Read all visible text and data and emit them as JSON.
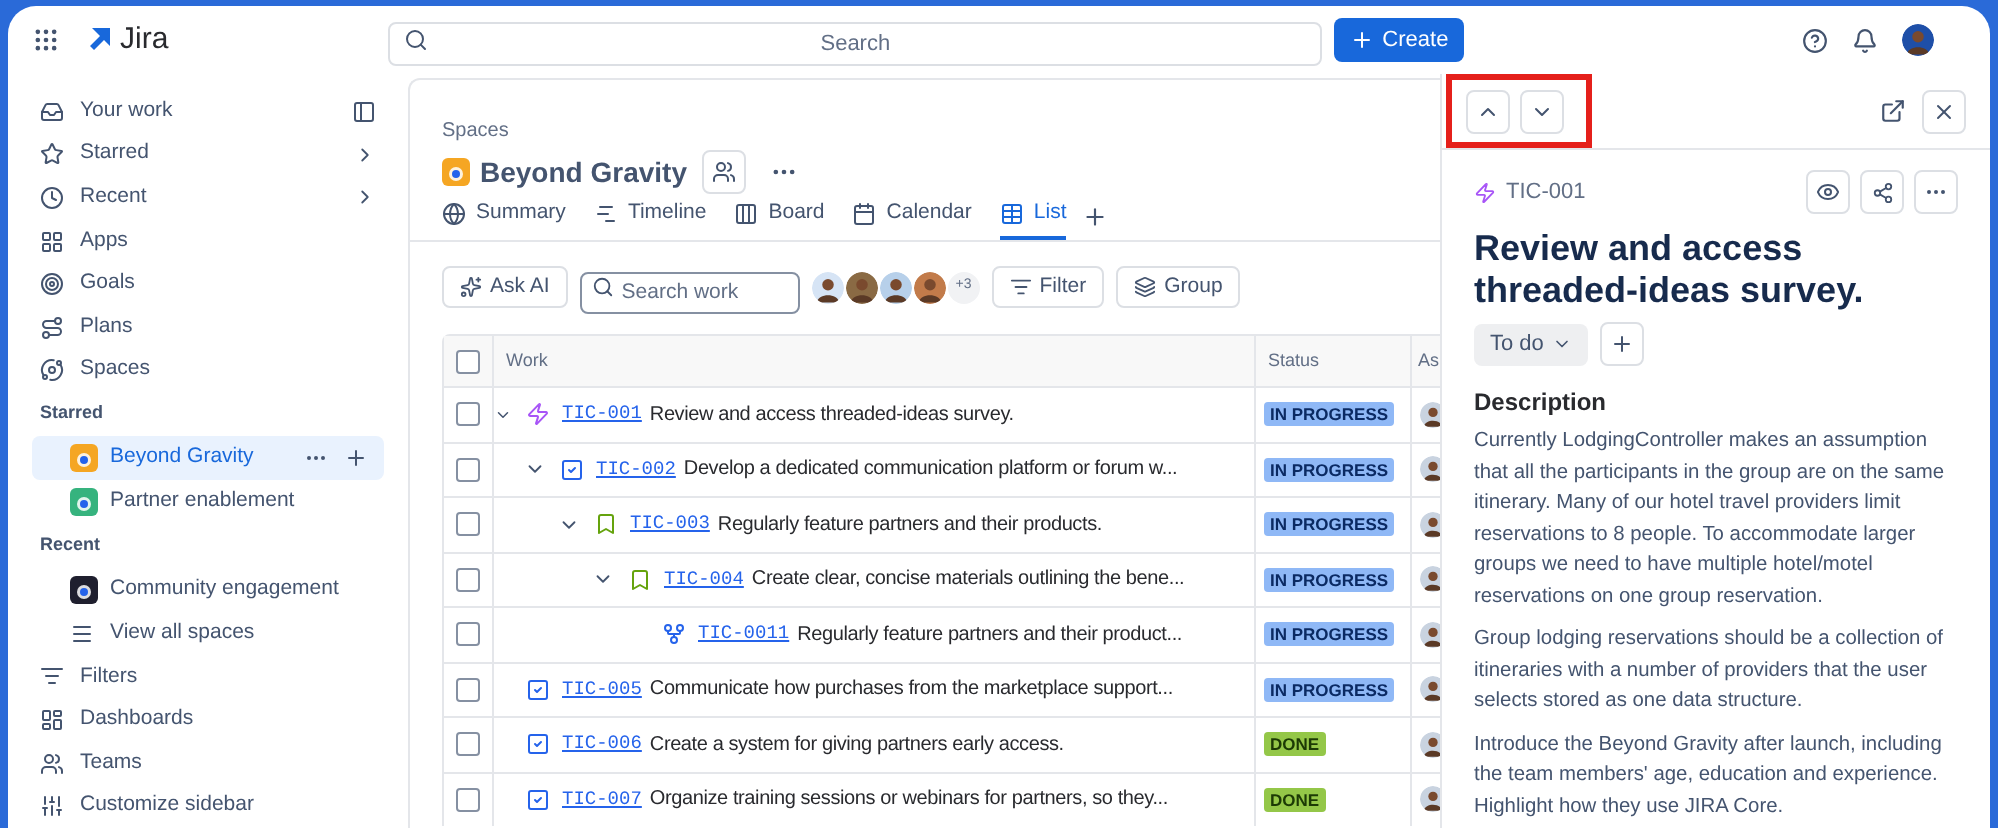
{
  "topbar": {
    "product": "Jira",
    "search": {
      "placeholder": "Search"
    },
    "create_button": "Create"
  },
  "sidebar": {
    "items": [
      {
        "label": "Your work"
      },
      {
        "label": "Starred"
      },
      {
        "label": "Recent"
      },
      {
        "label": "Apps"
      },
      {
        "label": "Goals"
      },
      {
        "label": "Plans"
      },
      {
        "label": "Spaces"
      }
    ],
    "sections": [
      {
        "heading": "Starred",
        "spaces": [
          {
            "label": "Beyond Gravity",
            "color": "#f5a623",
            "selected": true
          },
          {
            "label": "Partner enablement",
            "color": "#36b37e",
            "selected": false
          }
        ]
      },
      {
        "heading": "Recent",
        "spaces": [
          {
            "label": "Community engagement",
            "color": "#1f1f2e",
            "selected": false
          }
        ]
      }
    ],
    "view_all": "View all spaces",
    "bottom_items": [
      {
        "label": "Filters"
      },
      {
        "label": "Dashboards"
      },
      {
        "label": "Teams"
      },
      {
        "label": "Customize sidebar"
      }
    ]
  },
  "space": {
    "breadcrumb": "Spaces",
    "title": "Beyond Gravity",
    "tabs": [
      {
        "label": "Summary",
        "selected": false
      },
      {
        "label": "Timeline",
        "selected": false
      },
      {
        "label": "Board",
        "selected": false
      },
      {
        "label": "Calendar",
        "selected": false
      },
      {
        "label": "List",
        "selected": true
      }
    ]
  },
  "toolbar": {
    "ask_ai": "Ask AI",
    "search": {
      "placeholder": "Search work"
    },
    "more_people": "+3",
    "filter": "Filter",
    "group": "Group"
  },
  "table": {
    "columns": [
      "Work",
      "Status",
      "As"
    ],
    "all_checked": false,
    "rows": [
      {
        "key": "TIC-001",
        "kind": "epic",
        "summary": "Review and access threaded-ideas survey.",
        "status": {
          "label": "IN PROGRESS",
          "kind": "in_progress"
        },
        "checked": false,
        "expanded": true,
        "children": [
          {
            "key": "TIC-002",
            "kind": "task",
            "summary": "Develop a dedicated communication platform or forum w...",
            "status": {
              "label": "IN PROGRESS",
              "kind": "in_progress"
            },
            "checked": false,
            "expanded": true,
            "children": [
              {
                "key": "TIC-003",
                "kind": "story",
                "summary": "Regularly feature partners and their products.",
                "status": {
                  "label": "IN PROGRESS",
                  "kind": "in_progress"
                },
                "checked": false,
                "expanded": true,
                "children": [
                  {
                    "key": "TIC-004",
                    "kind": "story",
                    "summary": "Create clear, concise materials outlining the bene...",
                    "status": {
                      "label": "IN PROGRESS",
                      "kind": "in_progress"
                    },
                    "checked": false,
                    "expanded": true,
                    "children": [
                      {
                        "key": "TIC-0011",
                        "kind": "subtask",
                        "summary": "Regularly feature partners and their product...",
                        "status": {
                          "label": "IN PROGRESS",
                          "kind": "in_progress"
                        },
                        "checked": false
                      }
                    ]
                  }
                ]
              }
            ]
          }
        ]
      },
      {
        "key": "TIC-005",
        "kind": "task",
        "summary": "Communicate how purchases from the marketplace support...",
        "status": {
          "label": "IN PROGRESS",
          "kind": "in_progress"
        },
        "checked": false
      },
      {
        "key": "TIC-006",
        "kind": "task",
        "summary": "Create a system for giving partners early access.",
        "status": {
          "label": "DONE",
          "kind": "done"
        },
        "checked": false
      },
      {
        "key": "TIC-007",
        "kind": "task",
        "summary": "Organize training sessions or webinars for partners, so they...",
        "status": {
          "label": "DONE",
          "kind": "done"
        },
        "checked": false
      }
    ]
  },
  "detail": {
    "key": "TIC-001",
    "title": "Review and access threaded-ideas survey.",
    "status_button": "To do",
    "description_heading": "Description",
    "paragraphs": [
      "Currently LodgingController makes an assumption that all the participants in the group are on the same itinerary. Many of our hotel travel providers limit reservations to 8 people. To accommodate larger groups we need to have multiple hotel/motel reservations on one group reservation.",
      "Group lodging reservations should be a collection of itineraries with a number of providers that the user selects stored as one data structure.",
      "Introduce the Beyond Gravity after launch, including the team members' age, education and experience. Highlight how they use JIRA Core."
    ]
  }
}
